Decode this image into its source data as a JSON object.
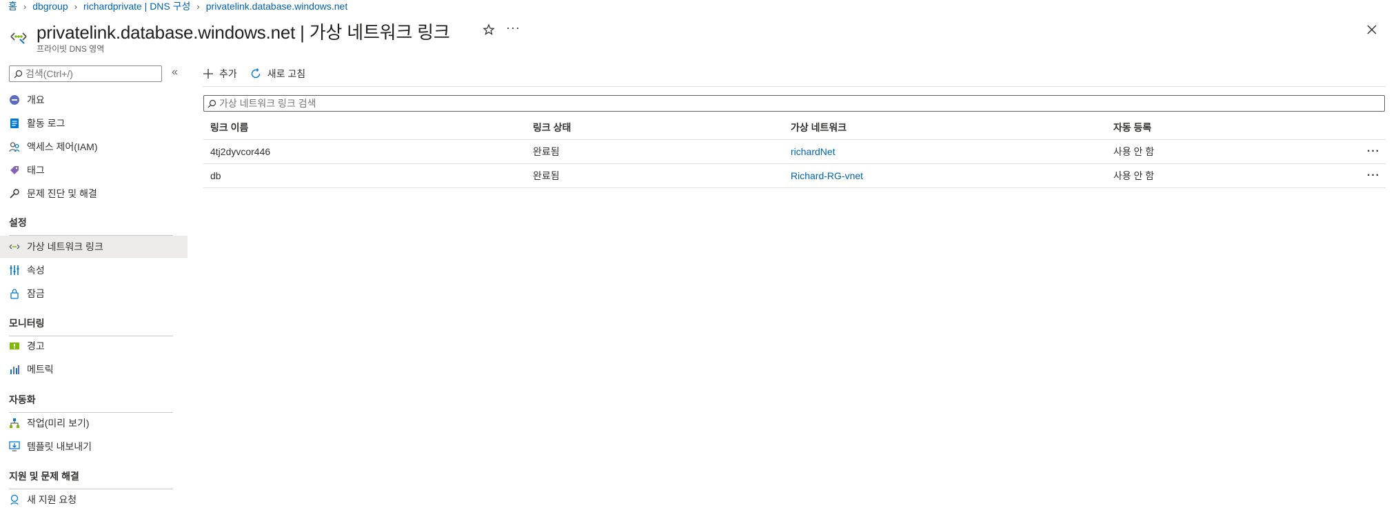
{
  "breadcrumb": [
    {
      "label": "홈"
    },
    {
      "label": "dbgroup"
    },
    {
      "label": "richardprivate | DNS 구성"
    },
    {
      "label": "privatelink.database.windows.net"
    }
  ],
  "header": {
    "title": "privatelink.database.windows.net | 가상 네트워크 링크",
    "subtitle": "프라이빗 DNS 영역",
    "more_label": "···",
    "icons": {
      "resource": "private-dns-zone-icon",
      "favorite": "star-icon",
      "close": "close-icon"
    }
  },
  "sidebar": {
    "search_placeholder": "검색(Ctrl+/)",
    "collapse_label": "«",
    "items_top": [
      {
        "label": "개요",
        "icon": "overview-icon"
      },
      {
        "label": "활동 로그",
        "icon": "activity-log-icon"
      },
      {
        "label": "액세스 제어(IAM)",
        "icon": "iam-icon"
      },
      {
        "label": "태그",
        "icon": "tag-icon"
      },
      {
        "label": "문제 진단 및 해결",
        "icon": "wrench-icon"
      }
    ],
    "sections": [
      {
        "title": "설정",
        "items": [
          {
            "label": "가상 네트워크 링크",
            "icon": "vnet-link-icon",
            "active": true
          },
          {
            "label": "속성",
            "icon": "properties-icon"
          },
          {
            "label": "잠금",
            "icon": "lock-icon"
          }
        ]
      },
      {
        "title": "모니터링",
        "items": [
          {
            "label": "경고",
            "icon": "alerts-icon"
          },
          {
            "label": "메트릭",
            "icon": "metrics-icon"
          }
        ]
      },
      {
        "title": "자동화",
        "items": [
          {
            "label": "작업(미리 보기)",
            "icon": "tasks-icon"
          },
          {
            "label": "템플릿 내보내기",
            "icon": "export-template-icon"
          }
        ]
      },
      {
        "title": "지원 및 문제 해결",
        "items": [
          {
            "label": "새 지원 요청",
            "icon": "support-request-icon"
          }
        ]
      }
    ]
  },
  "toolbar": {
    "add_label": "추가",
    "refresh_label": "새로 고침"
  },
  "grid": {
    "search_placeholder": "가상 네트워크 링크 검색",
    "columns": [
      "링크 이름",
      "링크 상태",
      "가상 네트워크",
      "자동 등록"
    ],
    "rows": [
      {
        "name": "4tj2dyvcor446",
        "status": "완료됨",
        "vnet": "richardNet",
        "auto": "사용 안 함",
        "more": "···"
      },
      {
        "name": "db",
        "status": "완료됨",
        "vnet": "Richard-RG-vnet",
        "auto": "사용 안 함",
        "more": "···"
      }
    ]
  },
  "colors": {
    "link": "#0062ad",
    "active_nav_bg": "#edebe9",
    "text": "#323130"
  }
}
